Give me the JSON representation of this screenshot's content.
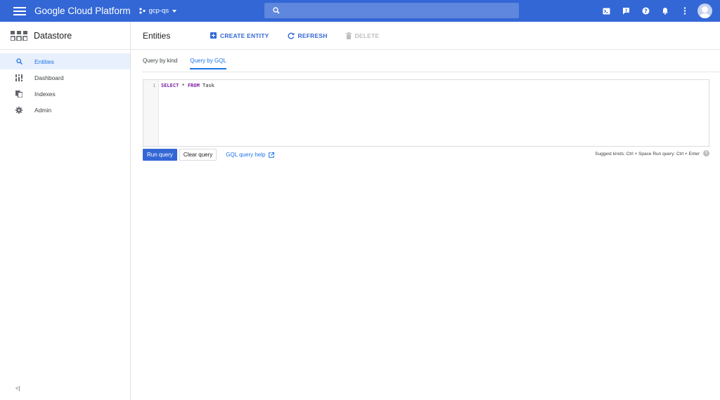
{
  "topbar": {
    "brand": "Google Cloud Platform",
    "project": "gcp-qs",
    "search_placeholder": ""
  },
  "sidebar": {
    "title": "Datastore",
    "items": [
      {
        "label": "Entities",
        "icon": "search-icon",
        "active": true
      },
      {
        "label": "Dashboard",
        "icon": "dashboard-icon",
        "active": false
      },
      {
        "label": "Indexes",
        "icon": "indexes-icon",
        "active": false
      },
      {
        "label": "Admin",
        "icon": "gear-icon",
        "active": false
      }
    ],
    "collapse_label": "<|"
  },
  "actionbar": {
    "title": "Entities",
    "create_label": "CREATE ENTITY",
    "refresh_label": "REFRESH",
    "delete_label": "DELETE"
  },
  "tabs": [
    {
      "label": "Query by kind",
      "active": false
    },
    {
      "label": "Query by GQL",
      "active": true
    }
  ],
  "editor": {
    "line_number": "1",
    "kw1": "SELECT",
    "mid": " * ",
    "kw2": "FROM",
    "rest": " Task"
  },
  "buttons": {
    "run_label": "Run query",
    "clear_label": "Clear query",
    "help_label": "GQL query help"
  },
  "hint": "Suggest kinds: Ctrl + Space Run query: Ctrl + Enter",
  "colors": {
    "brand_blue": "#3367d6",
    "link_blue": "#1a73e8"
  }
}
